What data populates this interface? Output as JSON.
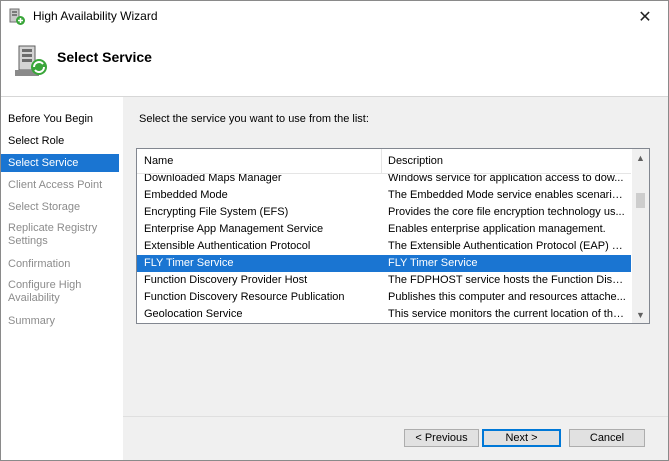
{
  "window": {
    "title": "High Availability Wizard"
  },
  "header": {
    "title": "Select Service"
  },
  "sidebar": {
    "steps": [
      {
        "label": "Before You Begin",
        "state": "done"
      },
      {
        "label": "Select Role",
        "state": "done"
      },
      {
        "label": "Select Service",
        "state": "active"
      },
      {
        "label": "Client Access Point",
        "state": "disabled"
      },
      {
        "label": "Select Storage",
        "state": "disabled"
      },
      {
        "label": "Replicate Registry Settings",
        "state": "disabled"
      },
      {
        "label": "Confirmation",
        "state": "disabled"
      },
      {
        "label": "Configure High Availability",
        "state": "disabled"
      },
      {
        "label": "Summary",
        "state": "disabled"
      }
    ]
  },
  "main": {
    "instruction": "Select the service you want to use from the list:",
    "list": {
      "columns": [
        "Name",
        "Description"
      ],
      "rows": [
        {
          "name": "Downloaded Maps Manager",
          "description": "Windows service for application access to dow..."
        },
        {
          "name": "Embedded Mode",
          "description": "The Embedded Mode service enables scenario..."
        },
        {
          "name": "Encrypting File System (EFS)",
          "description": "Provides the core file encryption technology us..."
        },
        {
          "name": "Enterprise App Management Service",
          "description": "Enables enterprise application management."
        },
        {
          "name": "Extensible Authentication Protocol",
          "description": "The Extensible Authentication Protocol (EAP) s..."
        },
        {
          "name": "FLY Timer Service",
          "description": "FLY Timer Service",
          "selected": true
        },
        {
          "name": "Function Discovery Provider Host",
          "description": "The FDPHOST service hosts the Function Disc..."
        },
        {
          "name": "Function Discovery Resource Publication",
          "description": "Publishes this computer and resources attache..."
        },
        {
          "name": "Geolocation Service",
          "description": "This service monitors the current location of the..."
        }
      ]
    }
  },
  "buttons": {
    "previous": "< Previous",
    "next": "Next >",
    "cancel": "Cancel"
  },
  "icons": {
    "close": "close-icon",
    "app": "cluster-wizard-icon",
    "header": "cluster-server-icon",
    "scroll_up": "scroll-up-icon",
    "scroll_down": "scroll-down-icon"
  },
  "colors": {
    "accent": "#1a75d2",
    "content_bg": "#f0f0f0",
    "disabled_text": "#8c8c8c"
  }
}
